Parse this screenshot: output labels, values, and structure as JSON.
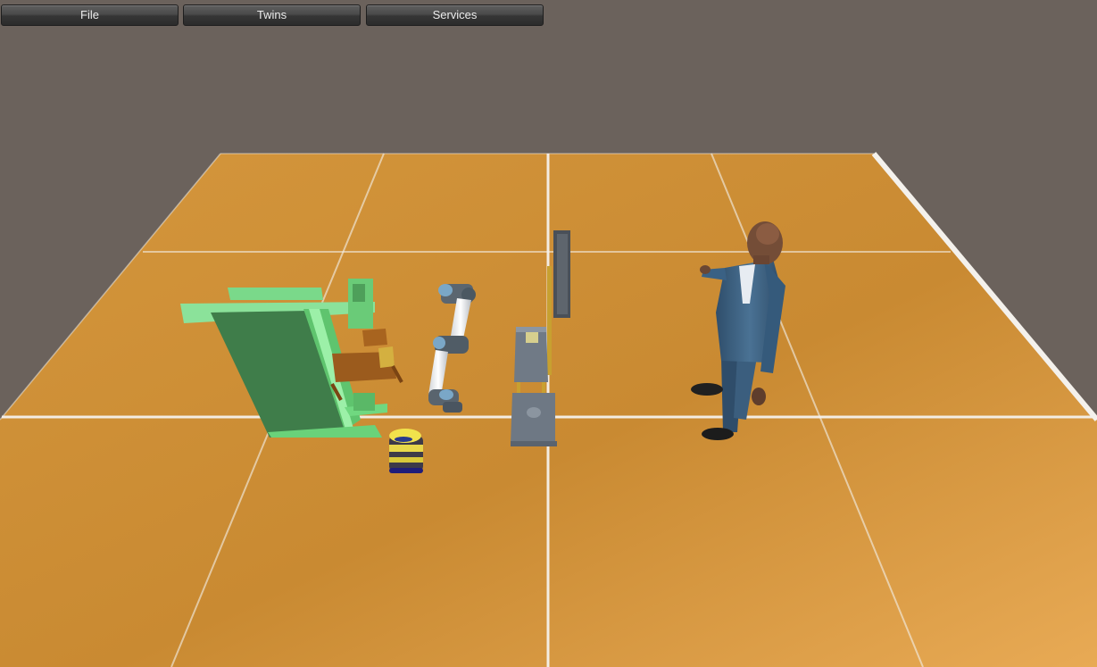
{
  "menu": {
    "file_label": "File",
    "twins_label": "Twins",
    "services_label": "Services"
  },
  "scene": {
    "background_color": "#6b625c",
    "floor_color": "#cf9138",
    "floor_highlight_color": "#e6a650",
    "grid_line_color": "#f4f1ec",
    "objects": [
      "welding-machine",
      "robot-arm",
      "mobile-robot",
      "workstation-table",
      "human-avatar"
    ]
  }
}
